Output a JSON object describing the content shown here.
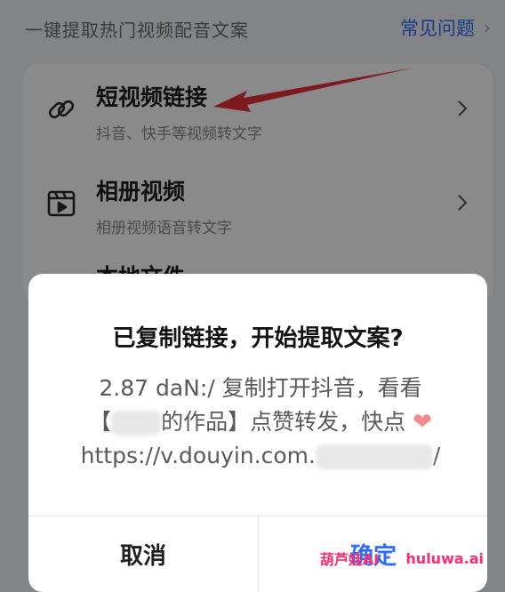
{
  "header": {
    "subtitle": "一键提取热门视频配音文案",
    "faq_label": "常见问题"
  },
  "menu": {
    "items": [
      {
        "title": "短视频链接",
        "desc": "抖音、快手等视频转文字",
        "icon": "link-icon"
      },
      {
        "title": "相册视频",
        "desc": "相册视频语音转文字",
        "icon": "video-album-icon"
      },
      {
        "title": "本地文件",
        "desc": "",
        "icon": ""
      }
    ]
  },
  "dialog": {
    "title": "已复制链接，开始提取文案?",
    "line1": "2.87 daN:/ 复制打开抖音，看看",
    "line2_prefix": "【",
    "line2_suffix": "的作品】点赞转发，快点",
    "line3": "https://v.douyin.com.",
    "line3_suffix": "/",
    "cancel_label": "取消",
    "ok_label": "确定"
  },
  "watermark": {
    "text": "葫芦娃AI",
    "site": "huluwa.ai"
  },
  "colors": {
    "accent": "#2b6cff",
    "annotation_arrow": "#e8313a"
  }
}
